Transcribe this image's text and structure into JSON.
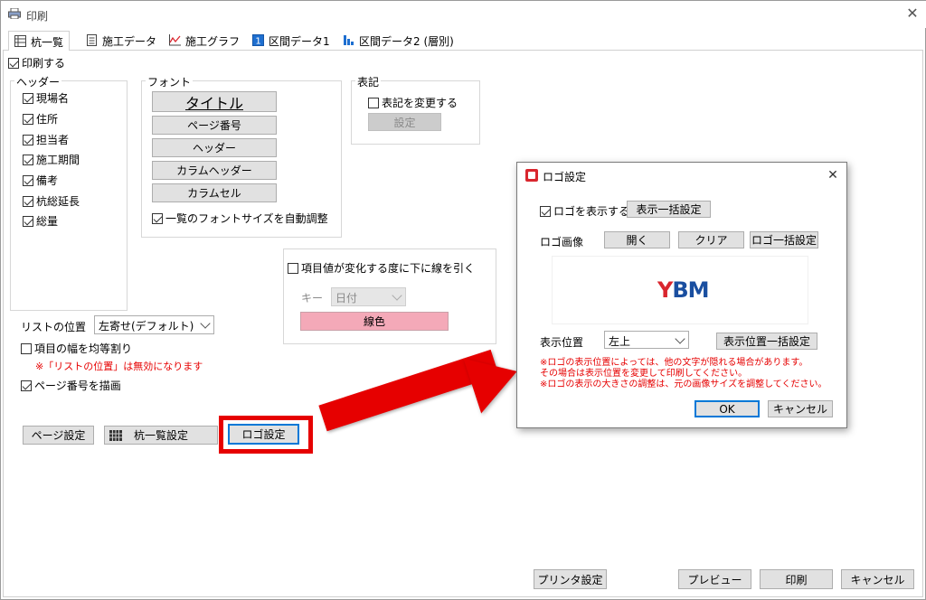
{
  "window": {
    "title": "印刷",
    "close": "✕"
  },
  "tabs": [
    {
      "label": "杭一覧",
      "icon": "table-icon"
    },
    {
      "label": "施工データ",
      "icon": "document-icon"
    },
    {
      "label": "施工グラフ",
      "icon": "line-chart-icon"
    },
    {
      "label": "区間データ1",
      "icon": "number-one-icon"
    },
    {
      "label": "区間データ2 (層別)",
      "icon": "layer-chart-icon"
    }
  ],
  "print_enabled": {
    "label": "印刷する",
    "checked": true
  },
  "header_group": {
    "title": "ヘッダー",
    "items": [
      {
        "label": "現場名",
        "checked": true
      },
      {
        "label": "住所",
        "checked": true
      },
      {
        "label": "担当者",
        "checked": true
      },
      {
        "label": "施工期間",
        "checked": true
      },
      {
        "label": "備考",
        "checked": true
      },
      {
        "label": "杭総延長",
        "checked": true
      },
      {
        "label": "総量",
        "checked": true
      }
    ]
  },
  "font_group": {
    "title": "フォント",
    "buttons": [
      "タイトル",
      "ページ番号",
      "ヘッダー",
      "カラムヘッダー",
      "カラムセル"
    ],
    "auto_adjust": {
      "label": "一覧のフォントサイズを自動調整",
      "checked": true
    }
  },
  "notation_group": {
    "title": "表記",
    "change": {
      "label": "表記を変更する",
      "checked": false
    },
    "settings_button": "設定"
  },
  "line_group": {
    "draw_line": {
      "label": "項目値が変化する度に下に線を引く",
      "checked": false
    },
    "key_label": "キー",
    "key_value": "日付",
    "line_color_button": "線色",
    "line_color": "#f4a9b8"
  },
  "list_position": {
    "label": "リストの位置",
    "value": "左寄せ(デフォルト)"
  },
  "equal_width": {
    "label": "項目の幅を均等割り",
    "checked": false
  },
  "equal_width_note": "※「リストの位置」は無効になります",
  "draw_page_number": {
    "label": "ページ番号を描画",
    "checked": true
  },
  "bottom_buttons": {
    "page_setup": "ページ設定",
    "pile_list_setup": "杭一覧設定",
    "logo_setup": "ロゴ設定",
    "printer_setup": "プリンタ設定",
    "preview": "プレビュー",
    "print": "印刷",
    "cancel": "キャンセル"
  },
  "logo_dialog": {
    "title": "ロゴ設定",
    "close": "✕",
    "show_logo": {
      "label": "ロゴを表示する",
      "checked": true
    },
    "show_bulk_button": "表示一括設定",
    "image_label": "ロゴ画像",
    "open_button": "開く",
    "clear_button": "クリア",
    "logo_bulk_button": "ロゴ一括設定",
    "logo_text_y": "Y",
    "logo_text_bm": "BM",
    "position_label": "表示位置",
    "position_value": "左上",
    "position_bulk_button": "表示位置一括設定",
    "notes": [
      "※ロゴの表示位置によっては、他の文字が隠れる場合があります。",
      "その場合は表示位置を変更して印刷してください。",
      "※ロゴの表示の大きさの調整は、元の画像サイズを調整してください。"
    ],
    "ok_button": "OK",
    "cancel_button": "キャンセル"
  },
  "colors": {
    "accent": "#0078d7",
    "annotation_red": "#e60000",
    "note_red": "#e60000"
  }
}
